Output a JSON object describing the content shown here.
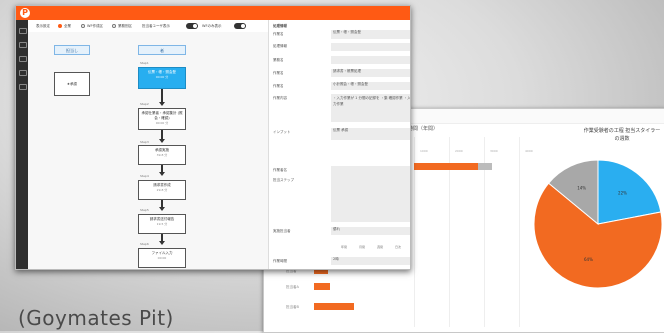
{
  "caption": "(Goymates Pit)",
  "app": {
    "logo": "P",
    "toolbar": [
      {
        "label": "表示設定",
        "kind": "text"
      },
      {
        "label": "全業",
        "kind": "radio",
        "on": true
      },
      {
        "label": "WF作成区",
        "kind": "radio",
        "on": false
      },
      {
        "label": "業務別区",
        "kind": "radio",
        "on": false
      },
      {
        "label": "担当者ユーザ表示",
        "kind": "toggle"
      },
      {
        "label": "WFのみ表示",
        "kind": "toggle"
      }
    ],
    "lanes": [
      "担当し",
      "者"
    ],
    "left_node": "★承認",
    "nodes": [
      {
        "step": "Step1",
        "title": "伝票・帳・照会登",
        "sub": "00:00 分",
        "selected": true
      },
      {
        "step": "Step2",
        "title": "承認仕業者・承認集計 (照会・確認)",
        "sub": "00:00 分",
        "selected": false
      },
      {
        "step": "Step3",
        "title": "承認実施",
        "sub": "39.8 分",
        "selected": false
      },
      {
        "step": "Step4",
        "title": "請求書作成",
        "sub": "29.8 分",
        "selected": false
      },
      {
        "step": "Step5",
        "title": "請求書送付報告",
        "sub": "19.5 分",
        "selected": false
      },
      {
        "step": "Step6",
        "title": "ファイル入力",
        "sub": "00:00",
        "selected": false
      }
    ],
    "props": {
      "header": "処理情報",
      "rows": [
        {
          "label": "作業名",
          "value": "伝票・帳・照会登"
        },
        {
          "label": "処理情報",
          "value": ""
        },
        {
          "label": "業務名",
          "value": ""
        },
        {
          "label": "作業名",
          "value": "請求書・帳票処理"
        },
        {
          "label": "作業名",
          "value": "小計照会・帳・照会登"
        },
        {
          "label": "作業内容",
          "value": "・入力作業が 1 分間の記録を ・集 確認作業 ・入力作業"
        },
        {
          "label": "インプット",
          "value": "伝票 承認"
        },
        {
          "label": "作業者名",
          "value": ""
        },
        {
          "label": "担当ステップ",
          "value": ""
        },
        {
          "label": "実施担当者",
          "value": "優れ"
        },
        {
          "label": "作業時間",
          "value": "2時"
        }
      ],
      "cols": [
        "年間",
        "月間",
        "週間",
        "日次"
      ]
    }
  },
  "dashboard": {
    "left_title": "作業時間（年間）",
    "right_title": "作業受験者の工程 担当スタイラーの週数",
    "x_ticks": [
      "0",
      "1000",
      "2000",
      "3000",
      "4000",
      "5000"
    ],
    "row_labels": [
      "担当者",
      "担当者A",
      "担当者B"
    ],
    "pie": {
      "colors": [
        "#2aaef0",
        "#f26a21",
        "#a8a8a8"
      ],
      "slices": [
        {
          "label": "22%",
          "value": 22
        },
        {
          "label": "64%",
          "value": 64
        },
        {
          "label": "14%",
          "value": 14
        }
      ]
    }
  }
}
